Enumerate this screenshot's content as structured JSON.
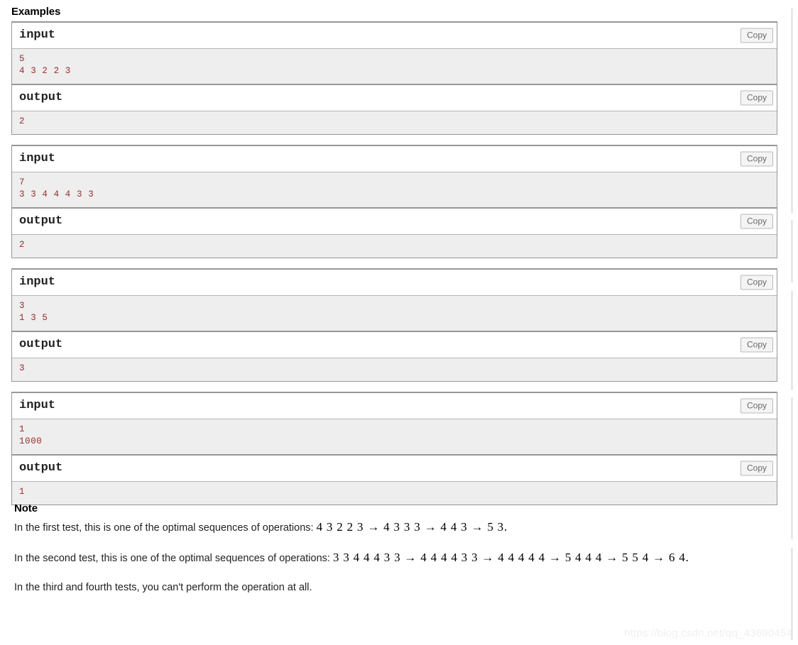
{
  "sections": {
    "examples_title": "Examples",
    "note_title": "Note"
  },
  "labels": {
    "input": "input",
    "output": "output",
    "copy": "Copy"
  },
  "colors": {
    "data_text": "#9a2b2b",
    "data_background": "#eeeeee",
    "block_border": "#979797",
    "heading": "#000000",
    "body_text": "#222222",
    "copy_button_text": "#6b6b6b",
    "copy_button_background": "#f4f4f4",
    "watermark": "#f0f0f0",
    "rule_mark": "#c3c3c3"
  },
  "examples": [
    {
      "input_label": "input",
      "input_data": "5\n4 3 2 2 3",
      "output_label": "output",
      "output_data": "2",
      "copy_input_label": "Copy",
      "copy_output_label": "Copy"
    },
    {
      "input_label": "input",
      "input_data": "7\n3 3 4 4 4 3 3",
      "output_label": "output",
      "output_data": "2",
      "copy_input_label": "Copy",
      "copy_output_label": "Copy"
    },
    {
      "input_label": "input",
      "input_data": "3\n1 3 5",
      "output_label": "output",
      "output_data": "3",
      "copy_input_label": "Copy",
      "copy_output_label": "Copy"
    },
    {
      "input_label": "input",
      "input_data": "1\n1000",
      "output_label": "output",
      "output_data": "1",
      "copy_input_label": "Copy",
      "copy_output_label": "Copy"
    }
  ],
  "note": {
    "paragraph1_lead": "In the first test, this is one of the optimal sequences of operations: ",
    "paragraph1_math": "4 3 2 2 3 → 4 3 3 3 → 4 4 3 → 5 3.",
    "paragraph2_lead": "In the second test, this is one of the optimal sequences of operations: ",
    "paragraph2_math": "3 3 4 4 4 3 3 → 4 4 4 4 3 3 → 4 4 4 4 4 → 5 4 4 4 → 5 5 4 → 6 4.",
    "paragraph3": "In the third and fourth tests, you can't perform the operation at all."
  },
  "watermark": "https://blog.csdn.net/qq_43690454"
}
